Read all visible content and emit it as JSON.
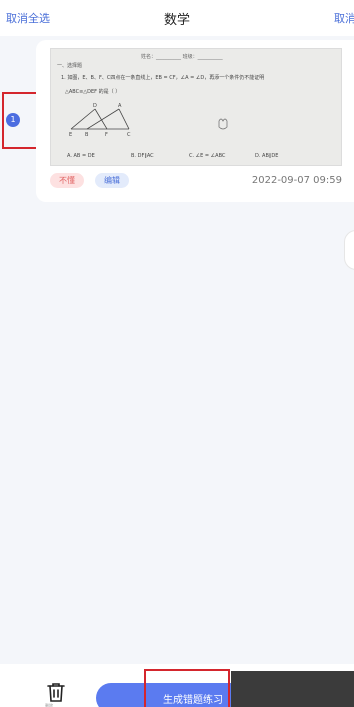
{
  "header": {
    "left_action": "取消全选",
    "title": "数学",
    "right_action": "取消"
  },
  "question_card": {
    "selection_index": "1",
    "tags": [
      "不懂",
      "编辑"
    ],
    "datetime": "2022-09-07 09:59",
    "thumbnail": {
      "header_line": "姓名：__________ 班级：__________",
      "section": "一、选择题",
      "question": "1. 如图，E、B、F、C四点在一条直线上，EB = CF，∠A = ∠D，再添一个条件仍不能证明",
      "question_cont": "△ABC≌△DEF 的是（    ）",
      "options": [
        "A. AB = DE",
        "B. DF∥AC",
        "C. ∠E = ∠ABC",
        "D. AB∥DE"
      ],
      "figure_labels": [
        "D",
        "A",
        "E",
        "B",
        "F",
        "C"
      ]
    }
  },
  "bottom_bar": {
    "delete_label": "删除",
    "generate_label": "生成错题练习"
  },
  "colors": {
    "accent": "#4a6fd8",
    "button": "#5b7bf0",
    "highlight": "#d4262d",
    "tag_dont_bg": "#fde1e1",
    "tag_edit_bg": "#e3ebfb"
  },
  "icons": {
    "delete": "trash-icon",
    "selection": "check-circle-icon"
  }
}
